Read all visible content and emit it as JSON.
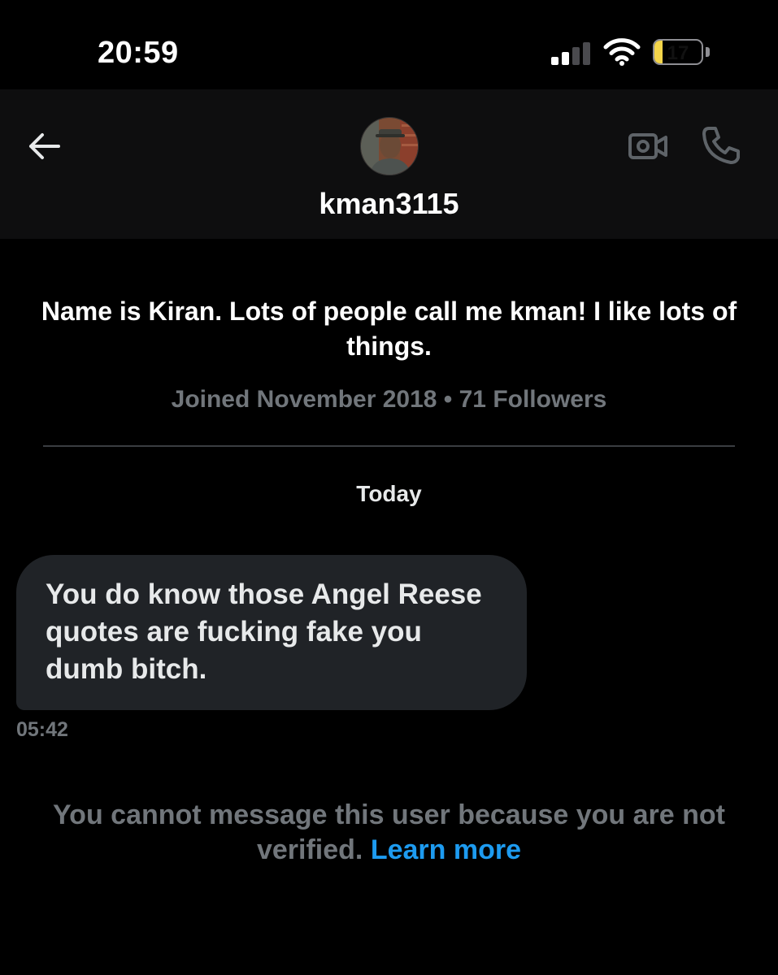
{
  "status_bar": {
    "time": "20:59",
    "signal_bars_active": 2,
    "signal_bars_total": 4,
    "battery_level": "17",
    "battery_fraction": 0.17,
    "battery_color": "#f4d54a"
  },
  "header": {
    "username": "kman3115",
    "icons": [
      "back-arrow-icon",
      "avatar",
      "video-call-icon",
      "phone-call-icon"
    ]
  },
  "profile": {
    "bio": "Name is Kiran. Lots of people call me kman! I like lots of things.",
    "meta": "Joined November 2018 • 71 Followers"
  },
  "conversation": {
    "day_label": "Today",
    "messages": [
      {
        "text": "You do know those Angel Reese quotes are fucking fake you dumb bitch.",
        "time": "05:42"
      }
    ]
  },
  "notice": {
    "text": "You cannot message this user because you are not verified.",
    "link": "Learn more",
    "link_color": "#1d9bf0"
  }
}
